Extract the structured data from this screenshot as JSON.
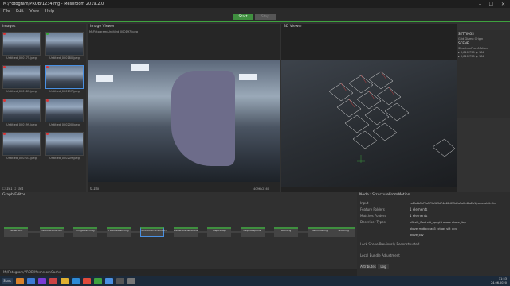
{
  "window": {
    "title": "M:/Fotogram/PROB/1234.mg - Meshroom 2019.2.0",
    "controls": "–  ☐  ✕"
  },
  "menu": {
    "items": [
      "File",
      "Edit",
      "View",
      "Help"
    ]
  },
  "toolbar": {
    "start_label": "Start",
    "stop_label": "Stop"
  },
  "images_panel": {
    "title": "Images",
    "thumbs": [
      {
        "caption": "Untitled_000175.jpeg",
        "status": "red"
      },
      {
        "caption": "Untitled_000180.jpeg",
        "status": "green"
      },
      {
        "caption": "Untitled_000181.jpeg",
        "status": "red"
      },
      {
        "caption": "Untitled_000197.jpeg",
        "status": "red"
      },
      {
        "caption": "Untitled_000199.jpeg",
        "status": "red"
      },
      {
        "caption": "Untitled_000200.jpeg",
        "status": "red"
      },
      {
        "caption": "Untitled_000203.jpeg",
        "status": "red"
      },
      {
        "caption": "Untitled_000209.jpeg",
        "status": "red"
      }
    ],
    "footer": "☐ 181   ☐ 184"
  },
  "image_viewer": {
    "title": "Image Viewer",
    "path": "M:/Fotogram/Untitled_000197.jpeg",
    "zoom": "0.18x",
    "resolution": "4096x2160"
  },
  "viewer_3d": {
    "title": "3D Viewer"
  },
  "settings": {
    "title": "SETTINGS",
    "row1": "Grid   Gizmo   Origin",
    "scene_title": "SCENE",
    "scene_node": "StructureFromMotion",
    "stats_1": "▸ 3,810,750  ◉ 184",
    "stats_2": "▸ 3,810,750  ◉ 184"
  },
  "graph_editor": {
    "title": "Graph Editor",
    "nodes": [
      "CameraInit",
      "FeatureExtraction",
      "ImageMatching",
      "FeatureMatching",
      "StructureFromMotion",
      "PrepareDenseScene",
      "DepthMap",
      "DepthMapFilter",
      "Meshing",
      "MeshFiltering",
      "Texturing"
    ]
  },
  "status_bar": {
    "path": "M:/Fotogram/PROB/MeshroomCache"
  },
  "inspector": {
    "title": "Node : StructureFromMotion",
    "rows": [
      {
        "key": "Input",
        "value": "ca1fa6b5b71a579a9b3d74d46c675d2a5a0e48a2b1/cameraInit.sfm"
      },
      {
        "key": "Feature Folders",
        "value": "1 elements"
      },
      {
        "key": "Matches Folders",
        "value": "1 elements"
      },
      {
        "key": "Describer Types",
        "value": "sift   sift_float   sift_upright   akaze   akaze_liop"
      },
      {
        "key": "",
        "value": "akaze_mldb   cctag3   cctag4   sift_ocv"
      },
      {
        "key": "",
        "value": "akaze_ocv"
      },
      {
        "key": "Lock Scene Previously Reconstructed",
        "value": ""
      },
      {
        "key": "Local Bundle Adjustment",
        "value": ""
      }
    ],
    "tabs": [
      "Attributes",
      "Log"
    ]
  },
  "taskbar": {
    "start": "Start",
    "time": "11:53",
    "date": "24.06.2020"
  },
  "colors": {
    "accent": "#3fa33f",
    "selection": "#4a90e2"
  }
}
